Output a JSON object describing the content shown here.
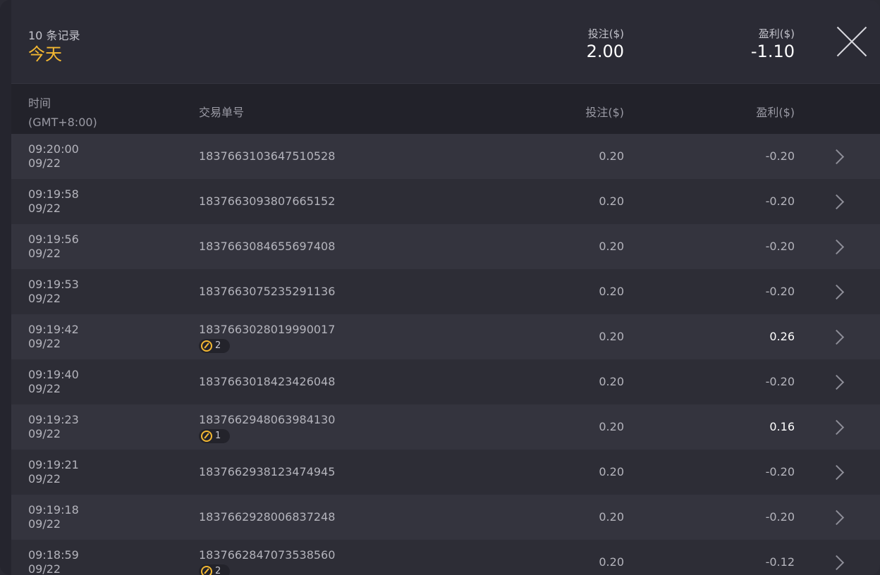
{
  "header": {
    "record_count": "10 条记录",
    "date_label": "今天",
    "bet_label": "投注($)",
    "bet_total": "2.00",
    "profit_label": "盈利($)",
    "profit_total": "-1.10"
  },
  "columns": {
    "time": "时间",
    "timezone": "(GMT+8:00)",
    "order_id": "交易单号",
    "bet": "投注($)",
    "profit": "盈利($)"
  },
  "rows": [
    {
      "time": "09:20:00",
      "date": "09/22",
      "order_id": "1837663103647510528",
      "bet": "0.20",
      "profit": "-0.20"
    },
    {
      "time": "09:19:58",
      "date": "09/22",
      "order_id": "1837663093807665152",
      "bet": "0.20",
      "profit": "-0.20"
    },
    {
      "time": "09:19:56",
      "date": "09/22",
      "order_id": "1837663084655697408",
      "bet": "0.20",
      "profit": "-0.20"
    },
    {
      "time": "09:19:53",
      "date": "09/22",
      "order_id": "1837663075235291136",
      "bet": "0.20",
      "profit": "-0.20"
    },
    {
      "time": "09:19:42",
      "date": "09/22",
      "order_id": "1837663028019990017",
      "badge": "2",
      "bet": "0.20",
      "profit": "0.26"
    },
    {
      "time": "09:19:40",
      "date": "09/22",
      "order_id": "1837663018423426048",
      "bet": "0.20",
      "profit": "-0.20"
    },
    {
      "time": "09:19:23",
      "date": "09/22",
      "order_id": "1837662948063984130",
      "badge": "1",
      "bet": "0.20",
      "profit": "0.16"
    },
    {
      "time": "09:19:21",
      "date": "09/22",
      "order_id": "1837662938123474945",
      "bet": "0.20",
      "profit": "-0.20"
    },
    {
      "time": "09:19:18",
      "date": "09/22",
      "order_id": "1837662928006837248",
      "bet": "0.20",
      "profit": "-0.20"
    },
    {
      "time": "09:18:59",
      "date": "09/22",
      "order_id": "1837662847073538560",
      "badge": "2",
      "bet": "0.20",
      "profit": "-0.12"
    }
  ],
  "colors": {
    "accent": "#f4b832",
    "background": "#2b2b35",
    "row_odd": "#34343e",
    "row_even": "#2d2d36"
  },
  "icons": {
    "close": "close-icon",
    "row_arrow": "chevron-right-icon",
    "badge": "spin-icon"
  }
}
